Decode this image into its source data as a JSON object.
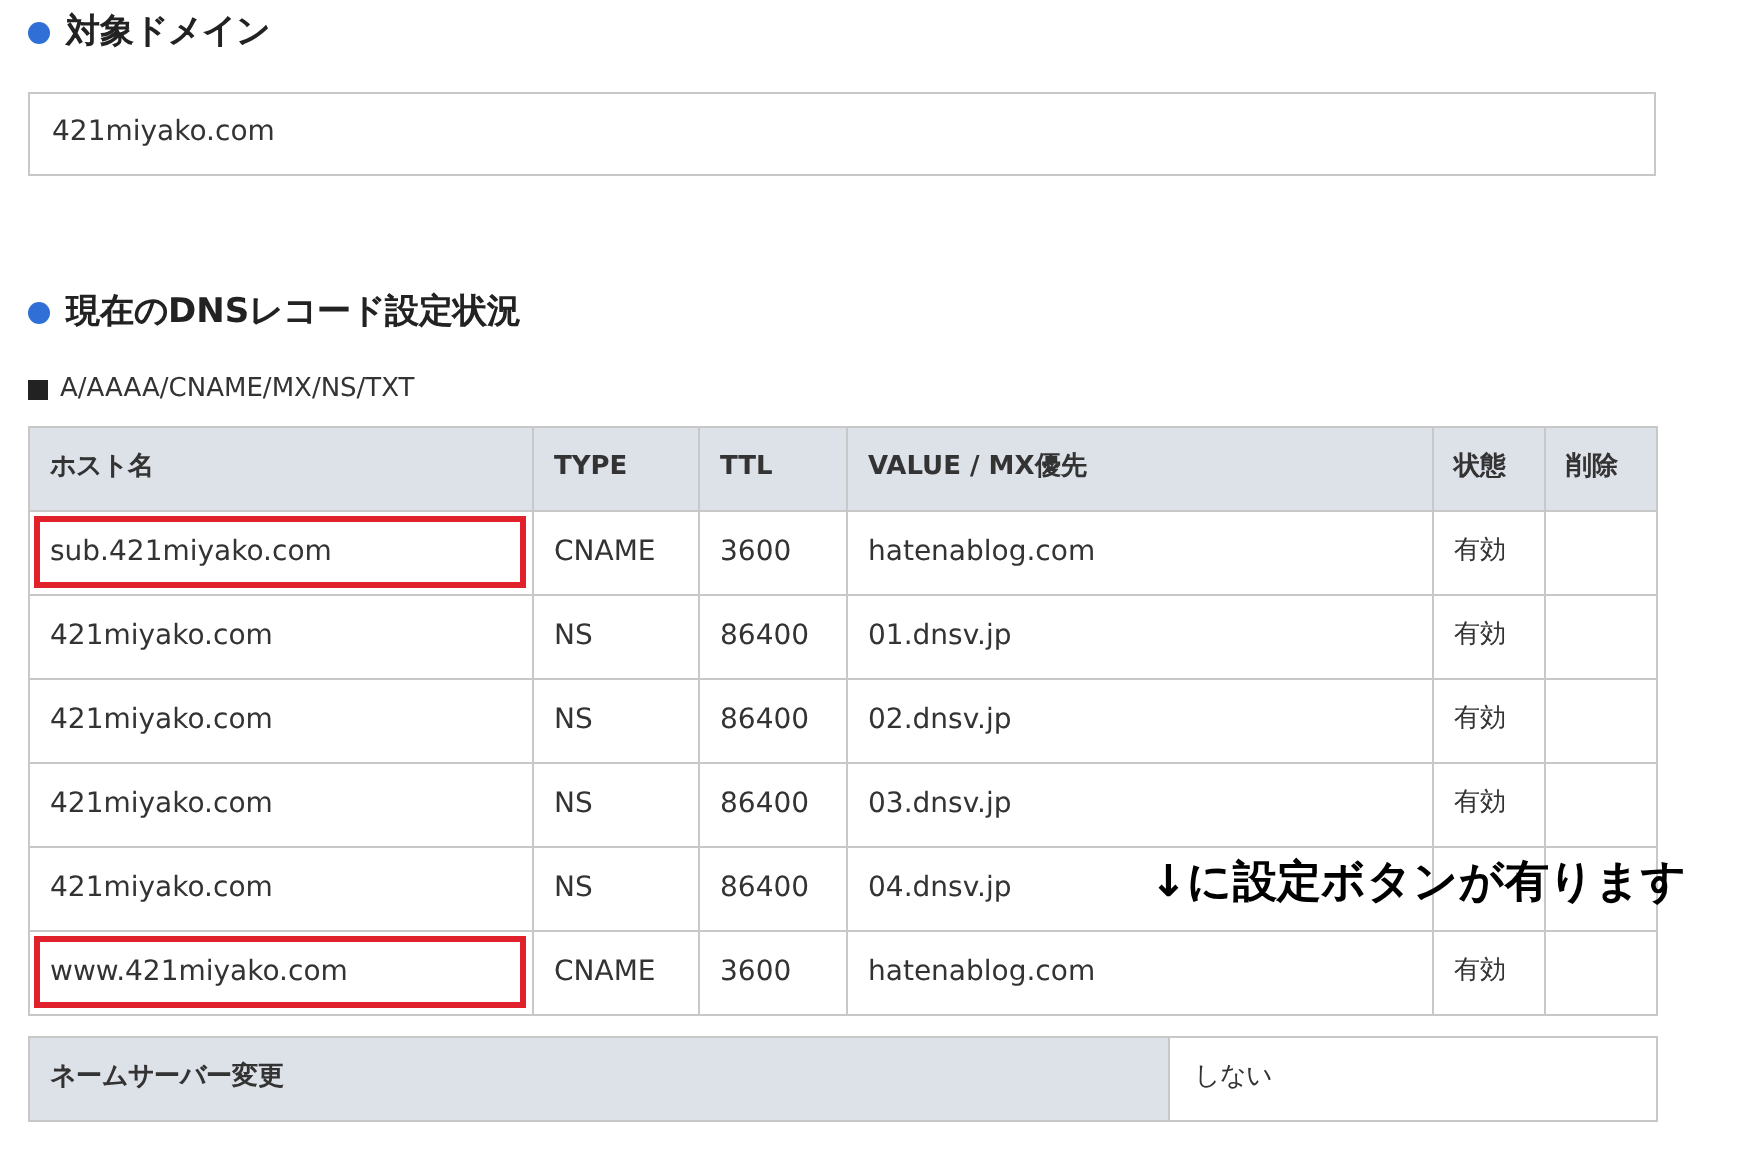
{
  "domain_section": {
    "title": "対象ドメイン",
    "domain": "421miyako.com"
  },
  "dns_section": {
    "title": "現在のDNSレコード設定状況",
    "record_types": "A/AAAA/CNAME/MX/NS/TXT",
    "table": {
      "columns": [
        "ホスト名",
        "TYPE",
        "TTL",
        "VALUE / MX優先",
        "状態",
        "削除"
      ],
      "rows": [
        {
          "host": "sub.421miyako.com",
          "type": "CNAME",
          "ttl": "3600",
          "value": "hatenablog.com",
          "status": "有効",
          "highlighted": true
        },
        {
          "host": "421miyako.com",
          "type": "NS",
          "ttl": "86400",
          "value": "01.dnsv.jp",
          "status": "有効",
          "highlighted": false
        },
        {
          "host": "421miyako.com",
          "type": "NS",
          "ttl": "86400",
          "value": "02.dnsv.jp",
          "status": "有効",
          "highlighted": false
        },
        {
          "host": "421miyako.com",
          "type": "NS",
          "ttl": "86400",
          "value": "03.dnsv.jp",
          "status": "有効",
          "highlighted": false
        },
        {
          "host": "421miyako.com",
          "type": "NS",
          "ttl": "86400",
          "value": "04.dnsv.jp",
          "highlighted": false
        },
        {
          "host": "www.421miyako.com",
          "type": "CNAME",
          "ttl": "3600",
          "value": "hatenablog.com",
          "status": "有効",
          "highlighted": true
        }
      ]
    },
    "annotation": "↓に設定ボタンが有ります",
    "nameserver_change": {
      "label": "ネームサーバー変更",
      "value": "しない"
    }
  }
}
